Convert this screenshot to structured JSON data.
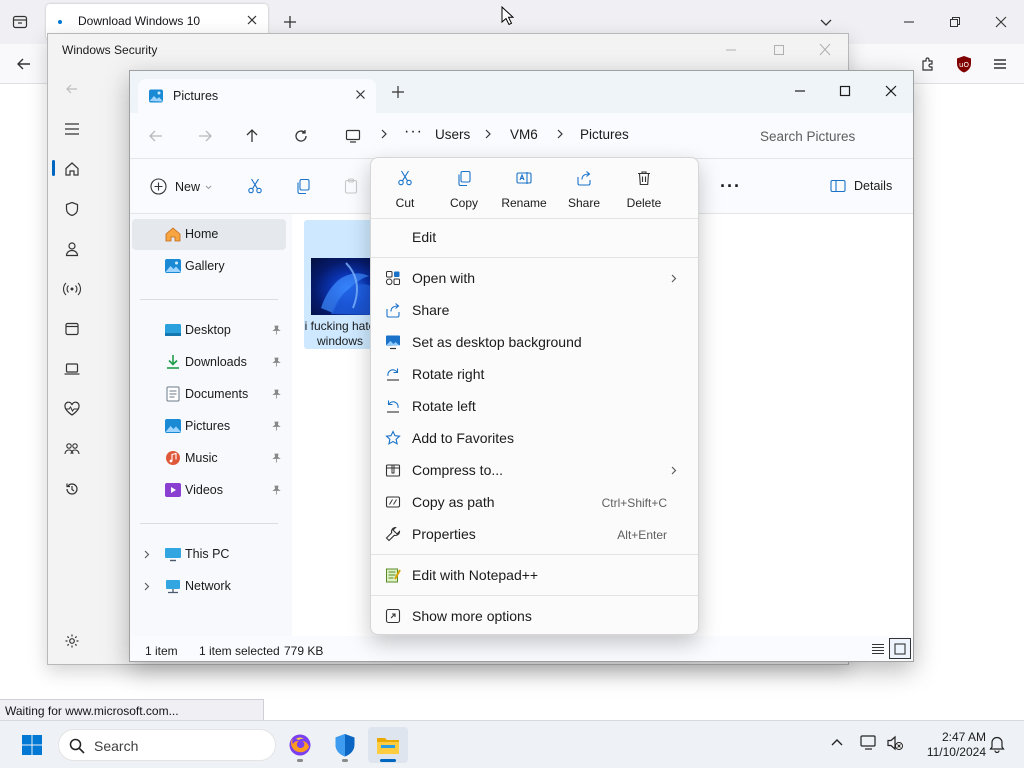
{
  "browser": {
    "tab_title": "Download Windows 10",
    "status_text": "Waiting for www.microsoft.com..."
  },
  "security_window": {
    "title": "Windows Security",
    "background_text_left": "",
    "background_text_right": ""
  },
  "explorer": {
    "tab_title": "Pictures",
    "breadcrumb": [
      "Users",
      "VM6",
      "Pictures"
    ],
    "search_placeholder": "Search Pictures",
    "toolbar": {
      "new_label": "New",
      "details_label": "Details"
    },
    "nav": {
      "home": "Home",
      "gallery": "Gallery",
      "quick_access": [
        "Desktop",
        "Downloads",
        "Documents",
        "Pictures",
        "Music",
        "Videos"
      ],
      "this_pc": "This PC",
      "network": "Network"
    },
    "file": {
      "name": "i fucking hate windows"
    },
    "status": {
      "count": "1 item",
      "selected": "1 item selected",
      "size": "779 KB"
    }
  },
  "context_menu": {
    "quick_actions": [
      "Cut",
      "Copy",
      "Rename",
      "Share",
      "Delete"
    ],
    "edit": "Edit",
    "items": [
      {
        "label": "Open with",
        "shortcut": ""
      },
      {
        "label": "Share",
        "shortcut": ""
      },
      {
        "label": "Set as desktop background",
        "shortcut": ""
      },
      {
        "label": "Rotate right",
        "shortcut": ""
      },
      {
        "label": "Rotate left",
        "shortcut": ""
      },
      {
        "label": "Add to Favorites",
        "shortcut": ""
      },
      {
        "label": "Compress to...",
        "shortcut": ""
      },
      {
        "label": "Copy as path",
        "shortcut": "Ctrl+Shift+C"
      },
      {
        "label": "Properties",
        "shortcut": "Alt+Enter"
      }
    ],
    "notepad": "Edit with Notepad++",
    "more": "Show more options"
  },
  "taskbar": {
    "search_placeholder": "Search",
    "time": "2:47 AM",
    "date": "11/10/2024"
  },
  "colors": {
    "accent": "#0067c0",
    "selection": "#cde8ff",
    "taskbar": "#eef1f6"
  }
}
